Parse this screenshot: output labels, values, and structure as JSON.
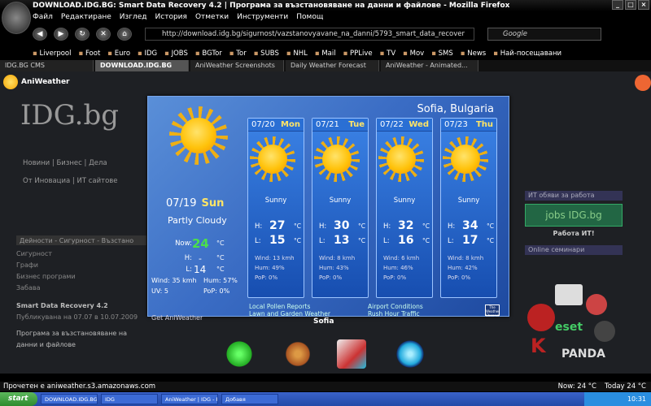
{
  "window": {
    "title": "DOWNLOAD.IDG.BG: Smart Data Recovery 4.2 | Програма за възстановяване на данни и файлове - Mozilla Firefox"
  },
  "menu": [
    "Файл",
    "Редактиране",
    "Изглед",
    "История",
    "Отметки",
    "Инструменти",
    "Помощ"
  ],
  "url": "http://download.idg.bg/sigurnost/vazstanovyavane_na_danni/5793_smart_data_recover",
  "search_placeholder": "Google",
  "bookmarks": [
    "Liverpool",
    "Foot",
    "Euro",
    "IDG",
    "JOBS",
    "BGTor",
    "Tor",
    "SUBS",
    "NHL",
    "Mail",
    "PPLive",
    "TV",
    "Mov",
    "SMS",
    "News",
    "Най-посещавани"
  ],
  "tabs": [
    {
      "label": "IDG.BG CMS"
    },
    {
      "label": "DOWNLOAD.IDG.BG"
    },
    {
      "label": "AniWeather Screenshots"
    },
    {
      "label": "Daily Weather Forecast"
    },
    {
      "label": "AniWeather - Animated..."
    }
  ],
  "aniweather_label": "AniWeather",
  "site": {
    "logo": "IDG.bg",
    "links1": "Новини | Бизнес | Дела",
    "links2": "От Иновациа | ИТ сайтове",
    "left_bar": "Дейности - Сигурност - Възстано",
    "left_items": [
      "Сигурност",
      "Графи",
      "Бизнес програми",
      "Забава"
    ],
    "article_title": "Smart Data Recovery 4.2",
    "article_sub": "Публикувана на 07.07 в 10.07.2009",
    "article_head": "Програма за възстановяване на данни и файлове",
    "right_hdr1": "ИТ обяви за работа",
    "right_ad": "jobs IDG.bg",
    "right_text": "Работа ИТ!",
    "right_hdr2": "Online семинари",
    "brands": [
      "eset",
      "PANDA"
    ]
  },
  "weather": {
    "city": "Sofia, Bulgaria",
    "today": {
      "date": "07/19",
      "dow": "Sun",
      "condition": "Partly Cloudy",
      "now_label": "Now:",
      "now": "24",
      "high_label": "H:",
      "high": "-",
      "low_label": "L:",
      "low": "14",
      "unit": "°C",
      "wind": "Wind: 35 kmh",
      "hum": "Hum: 57%",
      "uv": "UV: 5",
      "pop": "PoP: 0%"
    },
    "days": [
      {
        "date": "07/20",
        "dow": "Mon",
        "condition": "Sunny",
        "high": "27",
        "low": "15",
        "wind": "Wind: 13 kmh",
        "hum": "Hum: 49%",
        "pop": "PoP: 0%"
      },
      {
        "date": "07/21",
        "dow": "Tue",
        "condition": "Sunny",
        "high": "30",
        "low": "13",
        "wind": "Wind: 8 kmh",
        "hum": "Hum: 43%",
        "pop": "PoP: 0%"
      },
      {
        "date": "07/22",
        "dow": "Wed",
        "condition": "Sunny",
        "high": "32",
        "low": "16",
        "wind": "Wind: 6 kmh",
        "hum": "Hum: 46%",
        "pop": "PoP: 0%"
      },
      {
        "date": "07/23",
        "dow": "Thu",
        "condition": "Sunny",
        "high": "34",
        "low": "17",
        "wind": "Wind: 8 kmh",
        "hum": "Hum: 42%",
        "pop": "PoP: 0%"
      }
    ],
    "link1": "Local Pollen Reports",
    "link2": "Lawn and Garden Weather",
    "link3": "Airport Conditions",
    "link4": "Rush Hour Traffic",
    "link_left": "Get AniWeather",
    "brand": "The Weather Channel"
  },
  "dock_label": "Sofia",
  "status": {
    "text": "Прочетен е aniweather.s3.amazonaws.com",
    "now": "Now:  24 °C",
    "today": "Today  24 °C"
  },
  "taskbar": {
    "start": "start",
    "items": [
      "DOWNLOAD.IDG.BG...",
      "IDG",
      "AniWeather | IDG - F...",
      "Добавя"
    ],
    "clock": "10:31"
  }
}
